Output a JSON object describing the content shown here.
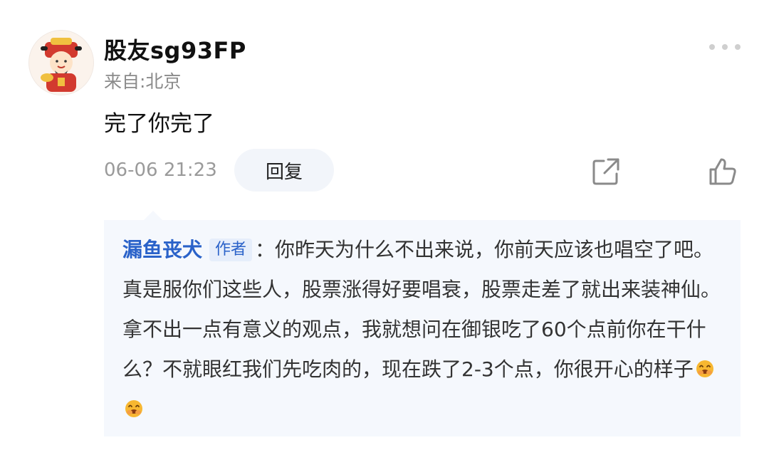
{
  "comment": {
    "username": "股友sg93FP",
    "location": "来自:北京",
    "text": "完了你完了",
    "time": "06-06 21:23",
    "reply_label": "回复",
    "avatar_icon": "caishen-avatar-icon",
    "more_icon": "more-dots-icon",
    "share_icon": "share-icon",
    "like_icon": "thumbs-up-icon"
  },
  "reply": {
    "author": "漏鱼丧犬",
    "badge": "作者",
    "text": "：你昨天为什么不出来说，你前天应该也唱空了吧。真是服你们这些人，股票涨得好要唱衰，股票走差了就出来装神仙。拿不出一点有意义的观点，我就想问在御银吃了60个点前你在干什么？不就眼红我们先吃肉的，现在跌了2-3个点，你很开心的样子",
    "emoji_icon": "laughing-emoji-icon",
    "emoji_count": 2
  },
  "colors": {
    "link_blue": "#2a62c9",
    "reply_bg": "#f5f8fd",
    "muted_gray": "#9a9a9a"
  }
}
